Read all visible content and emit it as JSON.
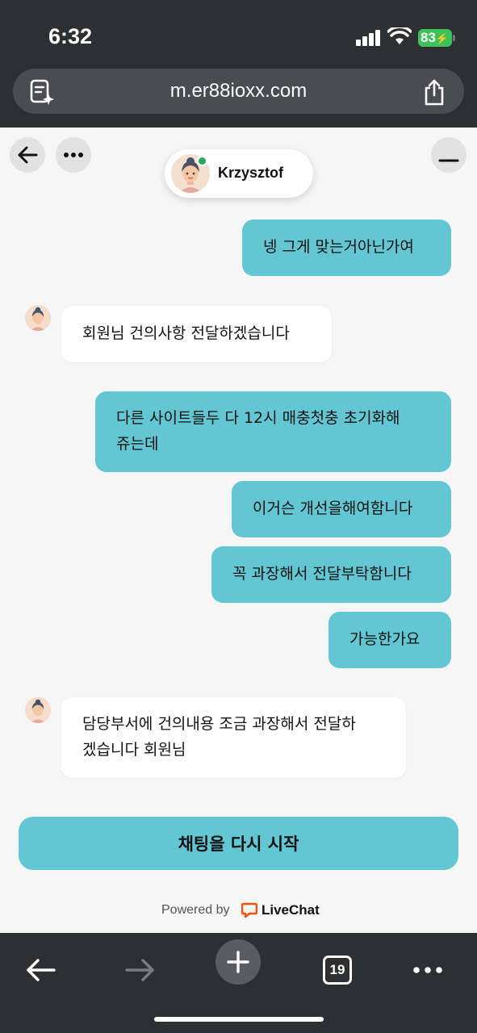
{
  "status_bar": {
    "time": "6:32",
    "battery": "83"
  },
  "browser": {
    "url": "m.er88ioxx.com",
    "tab_count": "19"
  },
  "chat": {
    "agent_name": "Krzysztof",
    "messages": [
      {
        "direction": "out",
        "text": "넹 그게 맞는거아닌가여"
      },
      {
        "direction": "in",
        "text": "회원님 건의사항 전달하겠습니다"
      },
      {
        "direction": "out",
        "line1": "다른 사이트들두 다 12시 매충첫충 초기화해",
        "line2": "쥬는데"
      },
      {
        "direction": "out",
        "text": "이거슨 개선을해여함니다"
      },
      {
        "direction": "out",
        "text": "꼭 과장해서 전달부탁함니다"
      },
      {
        "direction": "out",
        "text": "가능한가요"
      },
      {
        "direction": "in",
        "line1": "담당부서에 건의내용 조금 과장해서 전달하",
        "line2": "겠습니다 회원님"
      }
    ],
    "restart_label": "채팅을 다시 시작",
    "powered_by": "Powered by",
    "brand": "LiveChat"
  },
  "colors": {
    "bubble_out": "#62c6d3",
    "bubble_in": "#ffffff",
    "online": "#27a856",
    "brand_orange": "#ff5100"
  },
  "icons": [
    "reader-icon",
    "share-icon",
    "back-arrow-icon",
    "more-icon",
    "minimize-icon",
    "forward-arrow-icon",
    "new-tab-icon",
    "tabs-icon",
    "menu-icon"
  ]
}
